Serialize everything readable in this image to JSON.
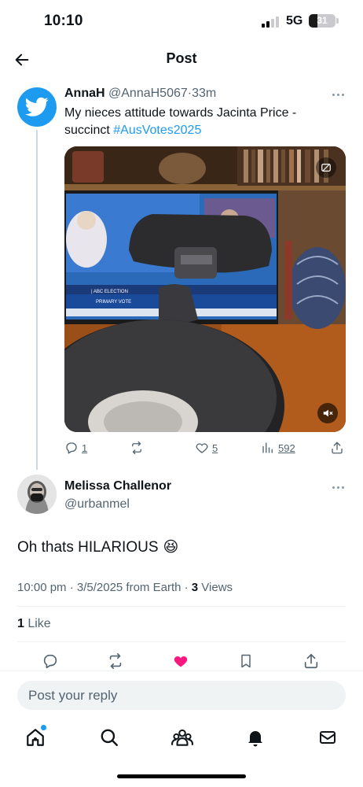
{
  "status_bar": {
    "time": "10:10",
    "network": "5G",
    "battery": "31",
    "battery_level": 0.31
  },
  "nav": {
    "title": "Post"
  },
  "tweet": {
    "author_name": "AnnaH",
    "author_handle": "@AnnaH5067",
    "separator": "·",
    "time_ago": "33m",
    "text_before": "My nieces attitude towards Jacinta Price - succinct ",
    "hashtag": "#AusVotes2025",
    "media_overlay_text": "| ABC ELECTION",
    "media_overlay_text2": "PRIMARY VOTE",
    "actions": {
      "replies": "1",
      "likes": "5",
      "views": "592"
    }
  },
  "reply": {
    "author_name": "Melissa Challenor",
    "author_handle": "@urbanmel",
    "text": "Oh thats HILARIOUS",
    "emoji": "😆",
    "meta_time": "10:00 pm · 3/5/2025 from Earth · ",
    "views_count": "3",
    "views_label": " Views",
    "likes_count": "1",
    "likes_label": " Like"
  },
  "composer": {
    "placeholder": "Post your reply"
  },
  "colors": {
    "accent": "#1d9bf0",
    "like": "#f91880",
    "text": "#0f1419",
    "muted": "#536471"
  },
  "icons": {
    "back": "arrow-left-icon",
    "more": "more-icon",
    "reply": "reply-icon",
    "repost": "repost-icon",
    "like": "heart-icon",
    "views": "analytics-icon",
    "share": "share-icon",
    "bookmark": "bookmark-icon",
    "home": "home-icon",
    "search": "search-icon",
    "communities": "communities-icon",
    "notifications": "bell-icon",
    "messages": "mail-icon",
    "mute": "mute-icon",
    "media_tag": "media-tag-icon"
  }
}
